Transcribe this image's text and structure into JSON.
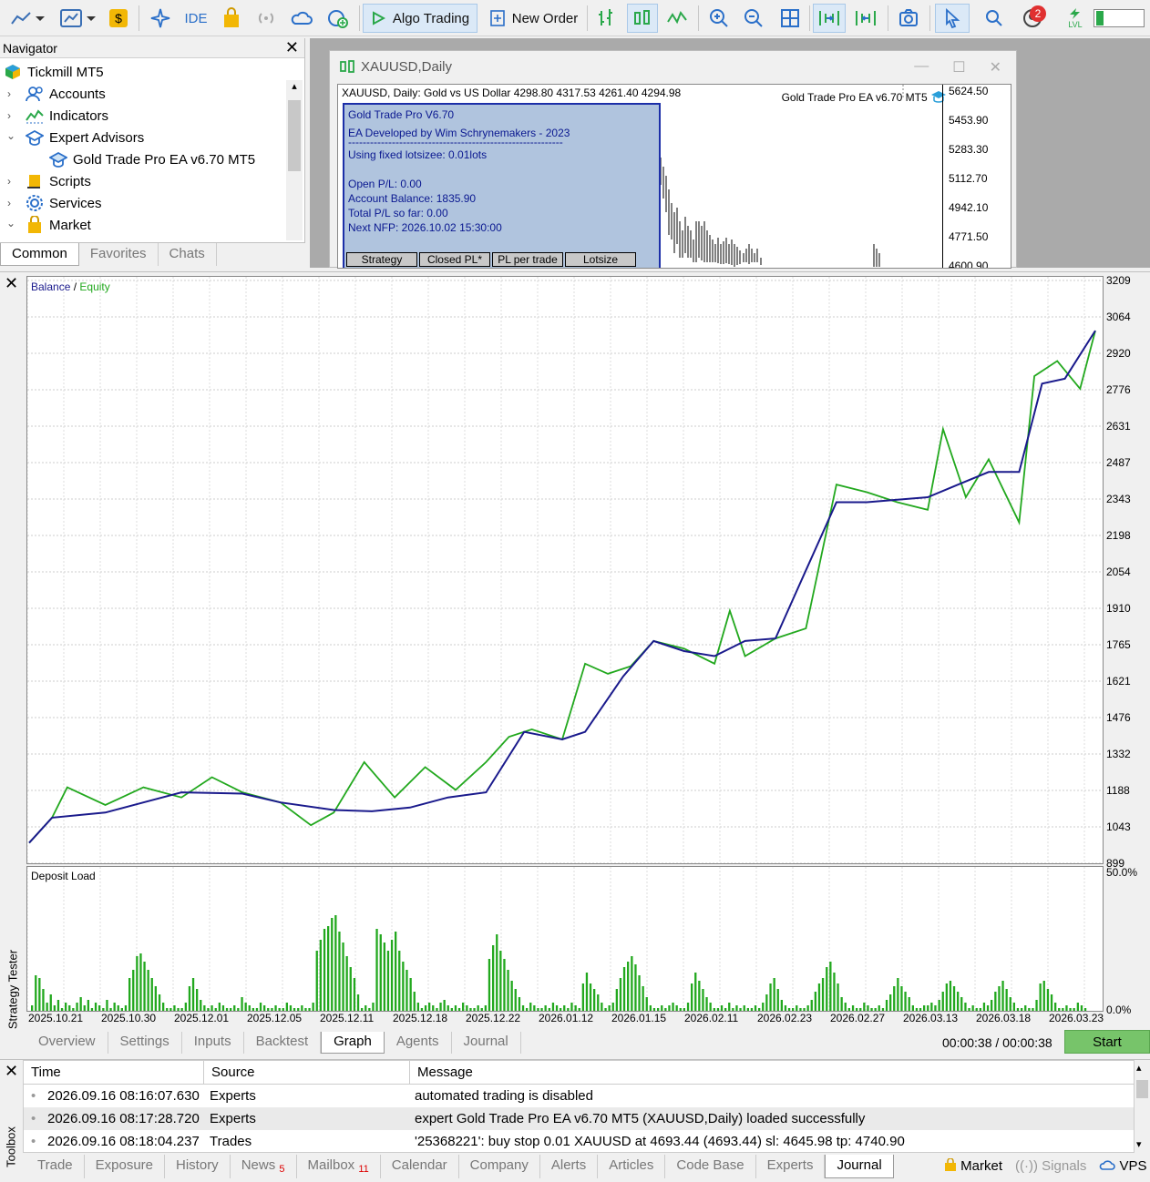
{
  "toolbar": {
    "ide_label": "IDE",
    "algo_trading_label": "Algo Trading",
    "new_order_label": "New Order",
    "notification_count": "2",
    "lvl_label": "LVL"
  },
  "navigator": {
    "title": "Navigator",
    "items": [
      {
        "label": "Tickmill MT5"
      },
      {
        "label": "Accounts"
      },
      {
        "label": "Indicators"
      },
      {
        "label": "Expert Advisors"
      },
      {
        "label": "Gold Trade Pro EA v6.70 MT5"
      },
      {
        "label": "Scripts"
      },
      {
        "label": "Services"
      },
      {
        "label": "Market"
      }
    ],
    "tabs": [
      "Common",
      "Favorites",
      "Chats"
    ]
  },
  "chart_window": {
    "title": "XAUUSD,Daily",
    "info_line": "XAUUSD, Daily:  Gold vs US Dollar   4298.80 4317.53 4261.40 4294.98",
    "ea_label": "Gold Trade Pro EA v6.70 MT5",
    "panel": {
      "line1": "Gold Trade Pro V6.70",
      "line2": "EA Developed by Wim Schrynemakers - 2023",
      "line3": "-----------------------------------------------------------",
      "line4": "Using fixed lotsizee: 0.01lots",
      "line5": "Open P/L: 0.00",
      "line6": "Account Balance: 1835.90",
      "line7": "Total P/L so far: 0.00",
      "line8": "Next NFP: 2026.10.02 15:30:00",
      "columns": [
        "Strategy",
        "Closed PL*",
        "PL per trade",
        "Lotsize"
      ]
    },
    "price_ticks": [
      "5624.50",
      "5453.90",
      "5283.30",
      "5112.70",
      "4942.10",
      "4771.50",
      "4600.90"
    ]
  },
  "tester": {
    "side_label": "Strategy Tester",
    "legend_balance": "Balance",
    "legend_sep": " / ",
    "legend_equity": "Equity",
    "load_label": "Deposit Load",
    "tabs": [
      "Overview",
      "Settings",
      "Inputs",
      "Backtest",
      "Graph",
      "Agents",
      "Journal"
    ],
    "elapsed": "00:00:38 / 00:00:38",
    "start_label": "Start"
  },
  "toolbox": {
    "side_label": "Toolbox",
    "columns": [
      "Time",
      "Source",
      "Message"
    ],
    "rows": [
      {
        "time": "2026.09.16 08:16:07.630",
        "source": "Experts",
        "message": "automated trading is disabled"
      },
      {
        "time": "2026.09.16 08:17:28.720",
        "source": "Experts",
        "message": "expert Gold Trade Pro EA v6.70 MT5 (XAUUSD,Daily) loaded successfully"
      },
      {
        "time": "2026.09.16 08:18:04.237",
        "source": "Trades",
        "message": "'25368221': buy stop 0.01 XAUUSD at 4693.44 (4693.44) sl: 4645.98 tp: 4740.90"
      }
    ],
    "tabs": [
      {
        "label": "Trade",
        "badge": ""
      },
      {
        "label": "Exposure",
        "badge": ""
      },
      {
        "label": "History",
        "badge": ""
      },
      {
        "label": "News",
        "badge": "5"
      },
      {
        "label": "Mailbox",
        "badge": "11"
      },
      {
        "label": "Calendar",
        "badge": ""
      },
      {
        "label": "Company",
        "badge": ""
      },
      {
        "label": "Alerts",
        "badge": ""
      },
      {
        "label": "Articles",
        "badge": ""
      },
      {
        "label": "Code Base",
        "badge": ""
      },
      {
        "label": "Experts",
        "badge": ""
      },
      {
        "label": "Journal",
        "badge": ""
      }
    ],
    "market_label": "Market",
    "signals_label": "Signals",
    "vps_label": "VPS"
  },
  "colors": {
    "balance": "#1a1a8c",
    "equity": "#22a81e",
    "accent": "#77c46a"
  },
  "chart_data": [
    {
      "type": "line",
      "legend": [
        "Balance",
        "Equity"
      ],
      "ylim": [
        899,
        3209
      ],
      "yticks": [
        "3209",
        "3064",
        "2920",
        "2776",
        "2631",
        "2487",
        "2343",
        "2198",
        "2054",
        "1910",
        "1765",
        "1621",
        "1476",
        "1332",
        "1188",
        "1043",
        "899"
      ],
      "x_labels": [
        "2025.10.21",
        "2025.10.30",
        "2025.12.01",
        "2025.12.05",
        "2025.12.11",
        "2025.12.18",
        "2025.12.22",
        "2026.01.12",
        "2026.01.15",
        "2026.02.11",
        "2026.02.23",
        "2026.02.27",
        "2026.03.13",
        "2026.03.18",
        "2026.03.23"
      ],
      "grid": true,
      "series": [
        {
          "name": "Balance",
          "x": [
            0,
            0.3,
            1,
            1.5,
            2,
            2.8,
            3.3,
            4,
            4.5,
            5,
            5.5,
            6,
            6.5,
            7,
            7.3,
            7.8,
            8.2,
            8.6,
            9,
            9.4,
            9.8,
            10.2,
            10.6,
            11,
            11.4,
            11.8,
            12.2,
            12.6,
            13,
            13.3,
            13.6,
            14
          ],
          "y": [
            980,
            1080,
            1100,
            1140,
            1180,
            1175,
            1140,
            1110,
            1105,
            1120,
            1160,
            1180,
            1420,
            1390,
            1420,
            1640,
            1780,
            1740,
            1720,
            1780,
            1790,
            2060,
            2330,
            2330,
            2340,
            2350,
            2400,
            2450,
            2450,
            2800,
            2820,
            3010
          ]
        },
        {
          "name": "Equity",
          "x": [
            0,
            0.3,
            0.5,
            1,
            1.5,
            2,
            2.4,
            2.8,
            3.3,
            3.7,
            4,
            4.4,
            4.8,
            5.2,
            5.6,
            6,
            6.3,
            6.6,
            7,
            7.3,
            7.6,
            7.9,
            8.2,
            8.6,
            9,
            9.2,
            9.4,
            9.8,
            10.2,
            10.6,
            11,
            11.4,
            11.8,
            12,
            12.3,
            12.6,
            13,
            13.2,
            13.5,
            13.8,
            14
          ],
          "y": [
            980,
            1080,
            1200,
            1130,
            1200,
            1160,
            1240,
            1180,
            1140,
            1050,
            1100,
            1300,
            1160,
            1280,
            1190,
            1300,
            1400,
            1430,
            1390,
            1690,
            1650,
            1680,
            1780,
            1750,
            1690,
            1900,
            1720,
            1790,
            1830,
            2400,
            2370,
            2330,
            2300,
            2620,
            2350,
            2500,
            2250,
            2830,
            2890,
            2780,
            3010
          ]
        }
      ]
    },
    {
      "type": "bar",
      "title": "Deposit Load",
      "ylim": [
        0,
        50
      ],
      "yticks": [
        "50.0%",
        "0.0%"
      ],
      "values": [
        2,
        13,
        12,
        8,
        3,
        6,
        2,
        4,
        1,
        3,
        2,
        1,
        3,
        5,
        2,
        4,
        1,
        3,
        2,
        1,
        4,
        1,
        3,
        2,
        1,
        2,
        12,
        15,
        20,
        21,
        18,
        15,
        12,
        9,
        6,
        3,
        1,
        1,
        2,
        1,
        1,
        3,
        9,
        12,
        8,
        4,
        2,
        1,
        2,
        1,
        3,
        2,
        1,
        1,
        2,
        1,
        5,
        3,
        2,
        1,
        1,
        3,
        2,
        1,
        1,
        2,
        1,
        1,
        3,
        2,
        1,
        1,
        2,
        1,
        1,
        3,
        22,
        26,
        30,
        31,
        34,
        35,
        29,
        25,
        20,
        16,
        12,
        6,
        1,
        2,
        1,
        3,
        30,
        28,
        25,
        22,
        26,
        29,
        22,
        18,
        15,
        12,
        7,
        3,
        1,
        2,
        3,
        2,
        1,
        3,
        4,
        2,
        1,
        2,
        1,
        3,
        2,
        1,
        1,
        2,
        1,
        2,
        19,
        24,
        28,
        22,
        19,
        15,
        11,
        8,
        5,
        2,
        1,
        3,
        2,
        1,
        1,
        2,
        1,
        3,
        2,
        1,
        2,
        1,
        3,
        2,
        1,
        10,
        14,
        10,
        8,
        6,
        3,
        1,
        2,
        3,
        8,
        12,
        16,
        18,
        20,
        17,
        13,
        9,
        5,
        2,
        1,
        1,
        2,
        1,
        2,
        3,
        2,
        1,
        1,
        3,
        10,
        14,
        11,
        8,
        5,
        3,
        1,
        1,
        2,
        1,
        3,
        1,
        2,
        1,
        2,
        1,
        1,
        2,
        1,
        3,
        6,
        10,
        12,
        8,
        4,
        2,
        1,
        1,
        2,
        1,
        1,
        2,
        4,
        7,
        10,
        12,
        16,
        18,
        14,
        10,
        5,
        3,
        1,
        2,
        1,
        1,
        3,
        2,
        1,
        1,
        2,
        1,
        4,
        6,
        9,
        12,
        9,
        7,
        5,
        2,
        1,
        1,
        2,
        2,
        3,
        2,
        4,
        7,
        10,
        11,
        9,
        7,
        5,
        3,
        1,
        2,
        1,
        1,
        3,
        2,
        4,
        7,
        9,
        11,
        8,
        5,
        3,
        1,
        1,
        2,
        1,
        1,
        4,
        10,
        11,
        8,
        6,
        3,
        1,
        1,
        2,
        1,
        1,
        3,
        2,
        1
      ]
    }
  ]
}
